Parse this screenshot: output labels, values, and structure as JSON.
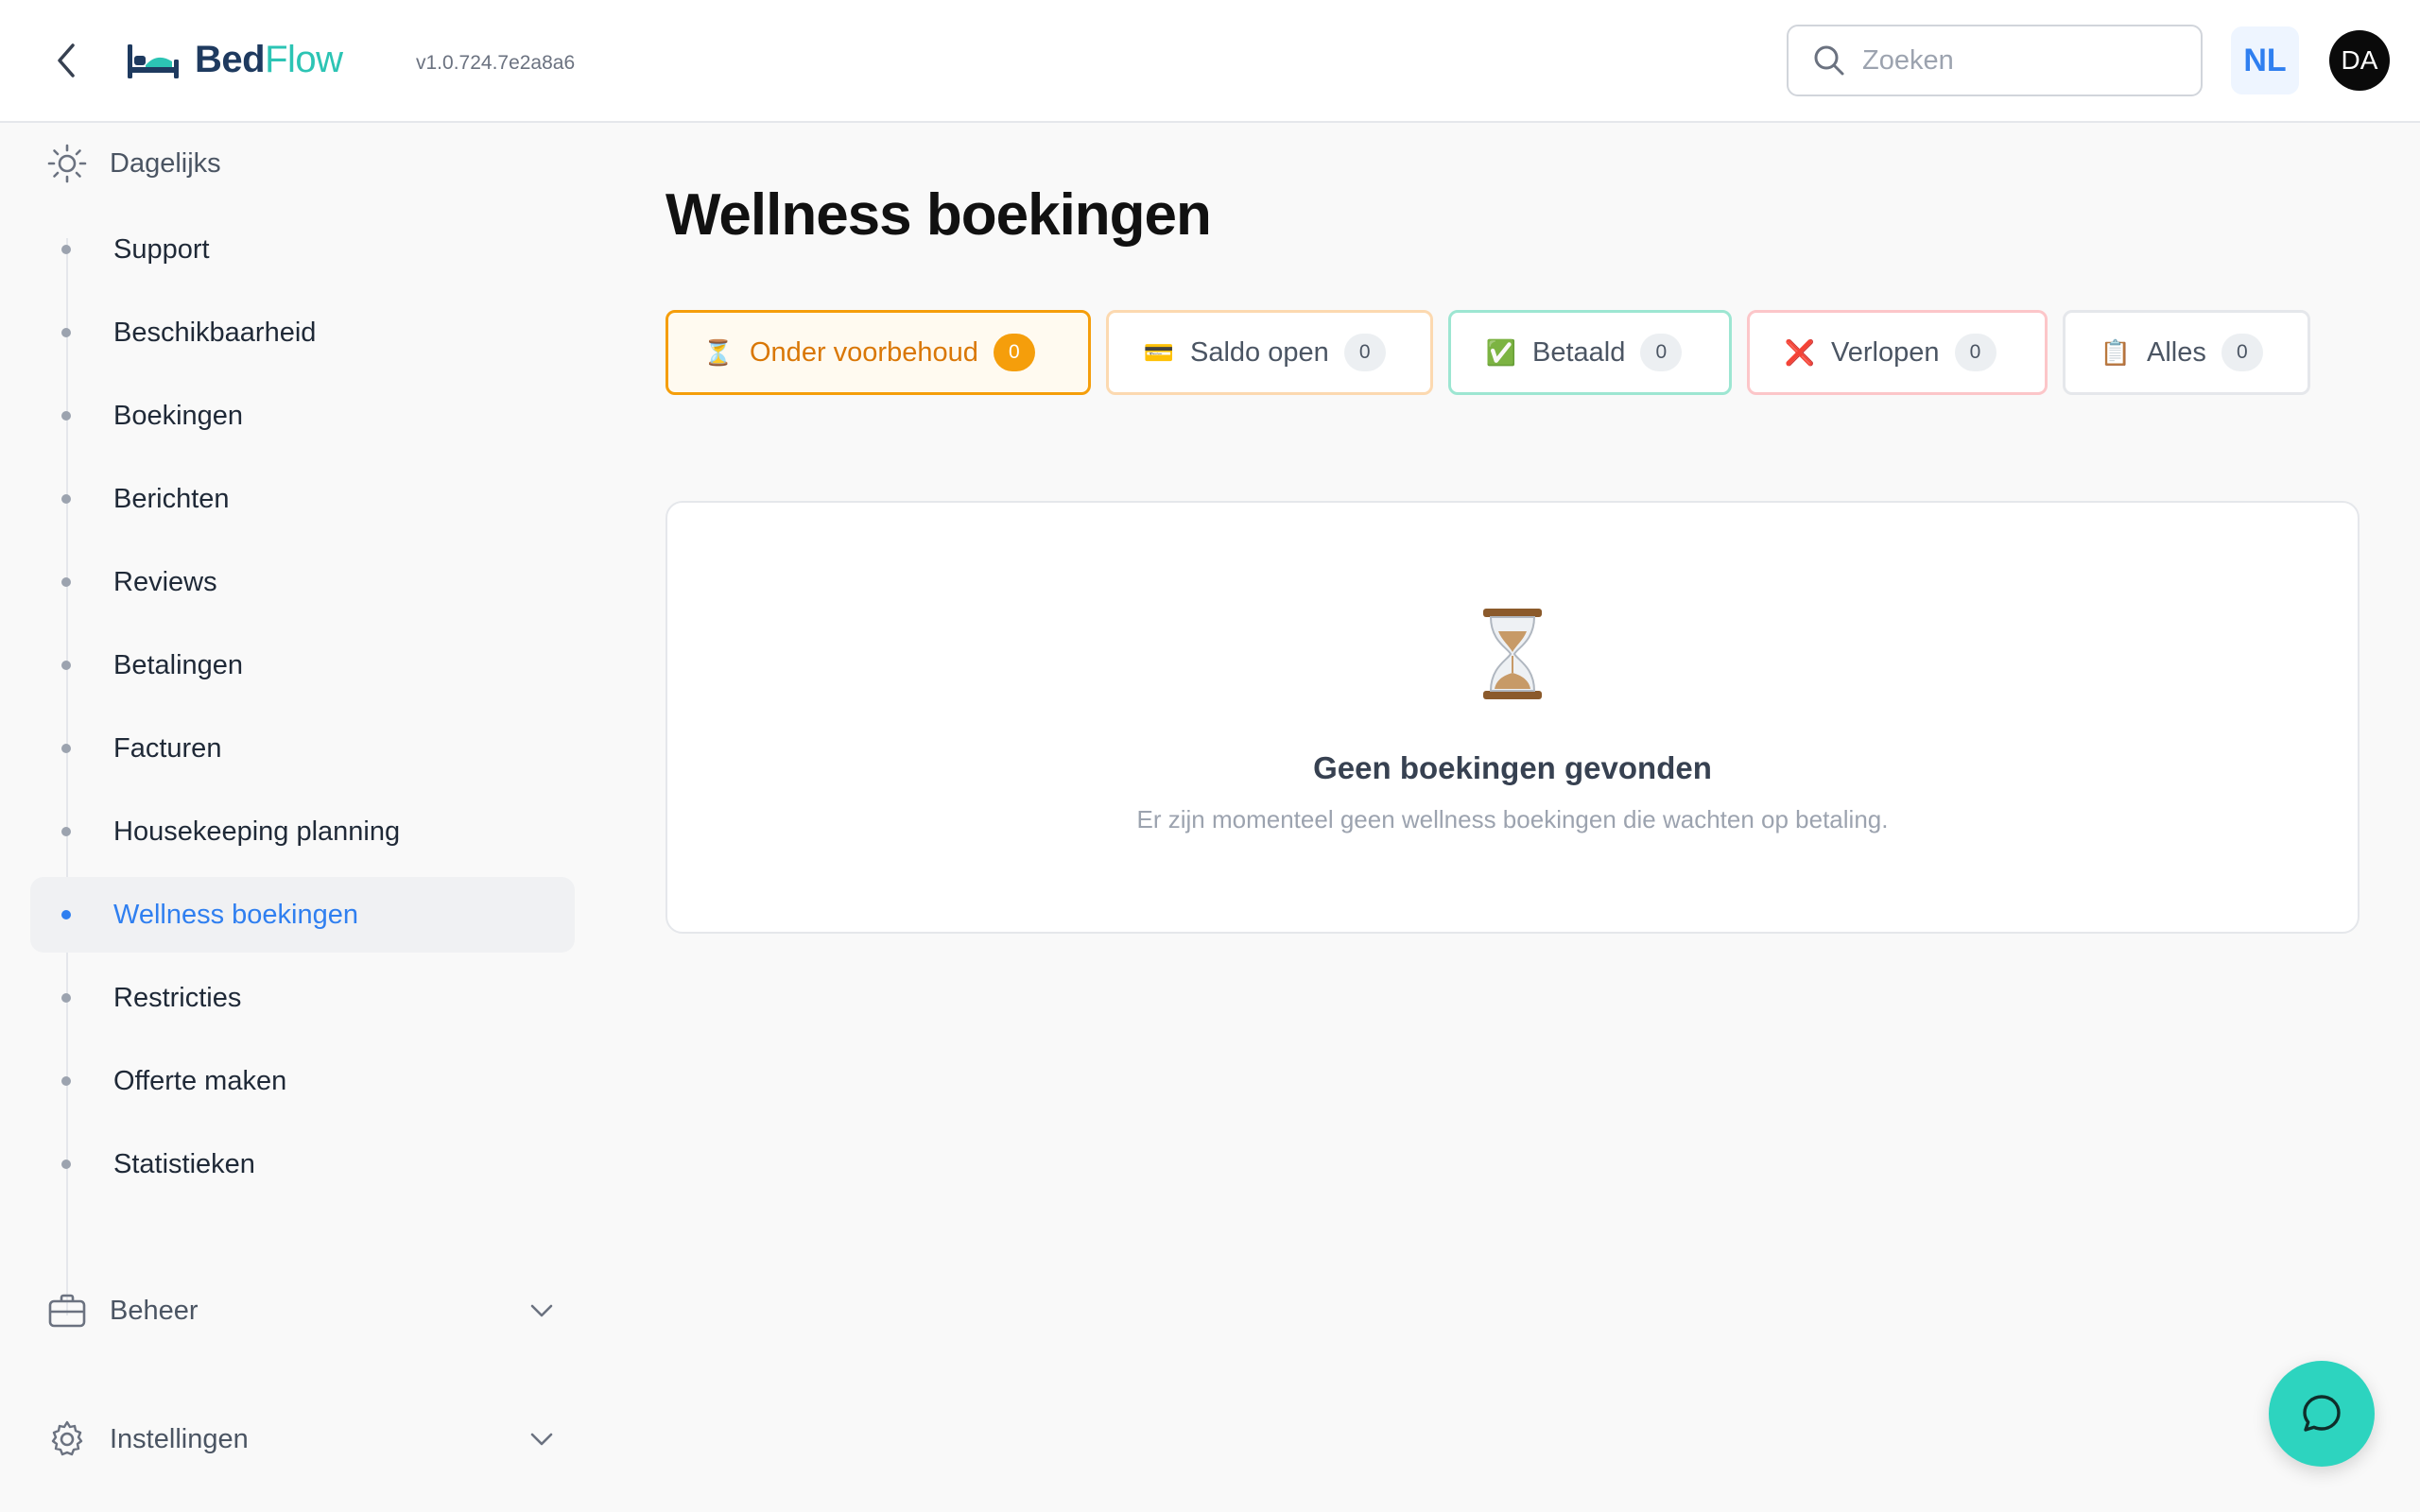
{
  "header": {
    "logo": {
      "part1": "Bed",
      "part2": "Flow"
    },
    "version": "v1.0.724.7e2a8a6",
    "search_placeholder": "Zoeken",
    "language": "NL",
    "avatar_initials": "DA"
  },
  "sidebar": {
    "daily_label": "Dagelijks",
    "items": [
      {
        "label": "Support"
      },
      {
        "label": "Beschikbaarheid"
      },
      {
        "label": "Boekingen"
      },
      {
        "label": "Berichten"
      },
      {
        "label": "Reviews"
      },
      {
        "label": "Betalingen"
      },
      {
        "label": "Facturen"
      },
      {
        "label": "Housekeeping planning"
      },
      {
        "label": "Wellness boekingen",
        "active": true
      },
      {
        "label": "Restricties"
      },
      {
        "label": "Offerte maken"
      },
      {
        "label": "Statistieken"
      }
    ],
    "manage_label": "Beheer",
    "settings_label": "Instellingen"
  },
  "main": {
    "title": "Wellness boekingen",
    "filters": [
      {
        "label": "Onder voorbehoud",
        "count": "0",
        "icon": "hourglass-icon",
        "emoji": "⏳"
      },
      {
        "label": "Saldo open",
        "count": "0",
        "icon": "credit-card-icon",
        "emoji": "💳"
      },
      {
        "label": "Betaald",
        "count": "0",
        "icon": "check-mark-icon",
        "emoji": "✅"
      },
      {
        "label": "Verlopen",
        "count": "0",
        "icon": "cross-mark-icon",
        "emoji": "❌"
      },
      {
        "label": "Alles",
        "count": "0",
        "icon": "clipboard-icon",
        "emoji": "📋"
      }
    ],
    "empty": {
      "title": "Geen boekingen gevonden",
      "subtitle": "Er zijn momenteel geen wellness boekingen die wachten op betaling."
    }
  },
  "colors": {
    "accent": "#2f7ff0",
    "brand_teal": "#2cc4b4",
    "pending": "#f59e0b",
    "chat": "#2dd4bf"
  }
}
